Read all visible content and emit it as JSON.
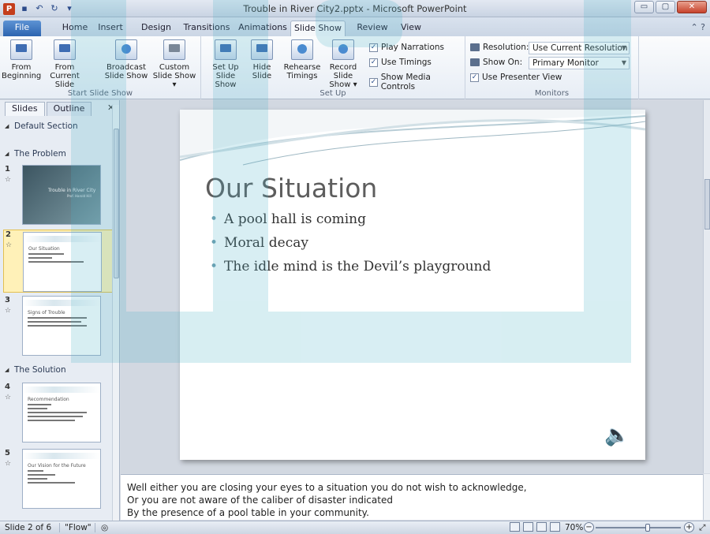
{
  "window": {
    "title": "Trouble in River City2.pptx - Microsoft PowerPoint",
    "app_icon": "P",
    "min": "▭",
    "max": "▢",
    "close": "✕"
  },
  "qat": {
    "save": "▪",
    "undo": "↶",
    "redo": "↻",
    "customize": "▾"
  },
  "tabs": [
    {
      "label": "File"
    },
    {
      "label": "Home"
    },
    {
      "label": "Insert"
    },
    {
      "label": "Design"
    },
    {
      "label": "Transitions"
    },
    {
      "label": "Animations"
    },
    {
      "label": "Slide Show"
    },
    {
      "label": "Review"
    },
    {
      "label": "View"
    }
  ],
  "ribbon": {
    "start_group": {
      "label": "Start Slide Show",
      "buttons": [
        {
          "line1": "From",
          "line2": "Beginning"
        },
        {
          "line1": "From",
          "line2": "Current Slide"
        },
        {
          "line1": "Broadcast",
          "line2": "Slide Show"
        },
        {
          "line1": "Custom",
          "line2": "Slide Show ▾"
        }
      ]
    },
    "setup_group": {
      "label": "Set Up",
      "buttons": [
        {
          "line1": "Set Up",
          "line2": "Slide Show"
        },
        {
          "line1": "Hide",
          "line2": "Slide"
        },
        {
          "line1": "Rehearse",
          "line2": "Timings"
        },
        {
          "line1": "Record Slide",
          "line2": "Show ▾"
        }
      ],
      "checks": [
        {
          "label": "Play Narrations",
          "checked": true
        },
        {
          "label": "Use Timings",
          "checked": true
        },
        {
          "label": "Show Media Controls",
          "checked": true
        }
      ]
    },
    "monitors_group": {
      "label": "Monitors",
      "resolution_label": "Resolution:",
      "resolution_value": "Use Current Resolution",
      "showon_label": "Show On:",
      "showon_value": "Primary Monitor",
      "presenter_label": "Use Presenter View",
      "presenter_checked": true
    }
  },
  "leftpane": {
    "tab_slides": "Slides",
    "tab_outline": "Outline",
    "close": "✕",
    "sections": [
      "Default Section",
      "The Problem",
      "The Solution"
    ],
    "slides": [
      {
        "num": "1",
        "title": "Trouble in River City",
        "sub": "Prof. Harold Hill",
        "dark": true
      },
      {
        "num": "2",
        "title": "Our Situation",
        "lines": 3,
        "selected": true
      },
      {
        "num": "3",
        "title": "Signs of Trouble",
        "lines": 3
      },
      {
        "num": "4",
        "title": "Recommendation",
        "lines": 5
      },
      {
        "num": "5",
        "title": "Our Vision for the Future",
        "lines": 4
      }
    ],
    "star": "☆"
  },
  "slide": {
    "title": "Our Situation",
    "bullets": [
      "A pool hall is coming",
      "Moral decay",
      "The idle mind is the Devil’s playground"
    ],
    "speaker": "🔈"
  },
  "notes": [
    "Well either you are closing your eyes to a situation you do not wish to acknowledge,",
    "Or you are not aware of the caliber of disaster indicated",
    "By the presence of a pool table in your community."
  ],
  "status": {
    "slide": "Slide 2 of 6",
    "theme": "\"Flow\"",
    "zoom": "70%",
    "zoom_minus": "−",
    "zoom_plus": "+"
  },
  "colors": {
    "accent": "#2c64b0",
    "watermark": "#4fb3c8"
  }
}
